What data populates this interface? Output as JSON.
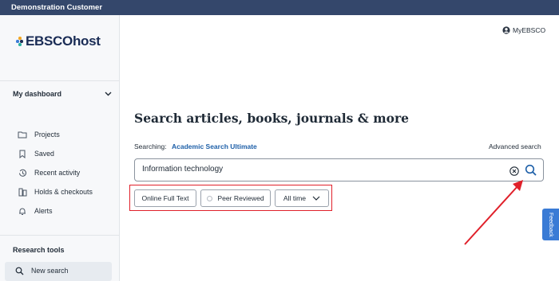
{
  "topbar": {
    "title": "Demonstration Customer"
  },
  "logo": {
    "text": "EBSCOhost"
  },
  "sidebar": {
    "dashboard_heading": "My dashboard",
    "items": [
      {
        "label": "Projects",
        "icon": "folder-icon"
      },
      {
        "label": "Saved",
        "icon": "bookmark-icon"
      },
      {
        "label": "Recent activity",
        "icon": "history-icon"
      },
      {
        "label": "Holds & checkouts",
        "icon": "holds-icon"
      },
      {
        "label": "Alerts",
        "icon": "bell-icon"
      }
    ],
    "tools_heading": "Research tools",
    "tools": [
      {
        "label": "New search",
        "icon": "search-icon"
      }
    ]
  },
  "header": {
    "account_label": "MyEBSCO"
  },
  "main": {
    "heading": "Search articles, books, journals & more",
    "searching_label": "Searching:",
    "database": "Academic Search Ultimate",
    "advanced_search": "Advanced search",
    "search": {
      "value": "Information technology"
    },
    "filters": [
      {
        "label": "Online Full Text"
      },
      {
        "label": "Peer Reviewed"
      },
      {
        "label": "All time"
      }
    ]
  },
  "feedback": {
    "label": "Feedback"
  },
  "colors": {
    "topbar": "#34476b",
    "link": "#1d5fa8",
    "annotation": "#e0202a",
    "feedback": "#3a7bd5"
  }
}
